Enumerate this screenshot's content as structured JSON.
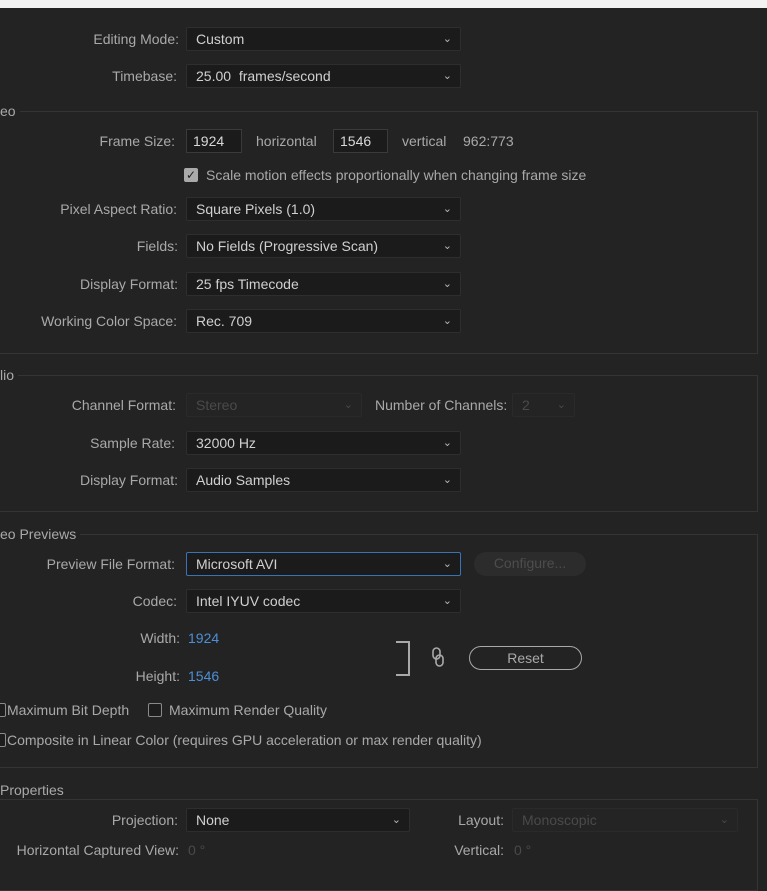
{
  "general": {
    "editing_mode": {
      "label": "Editing Mode:",
      "value": "Custom"
    },
    "timebase": {
      "label": "Timebase:",
      "value": "25.00  frames/second"
    }
  },
  "video": {
    "title": "eo",
    "frame_size": {
      "label": "Frame Size:",
      "width": "1924",
      "horizontal": "horizontal",
      "height": "1546",
      "vertical": "vertical",
      "ratio": "962:773"
    },
    "scale_checkbox": {
      "label": "Scale motion effects proportionally when changing frame size",
      "checked": true
    },
    "pixel_aspect": {
      "label": "Pixel Aspect Ratio:",
      "value": "Square Pixels (1.0)"
    },
    "fields": {
      "label": "Fields:",
      "value": "No Fields (Progressive Scan)"
    },
    "display_format": {
      "label": "Display Format:",
      "value": "25 fps Timecode"
    },
    "color_space": {
      "label": "Working Color Space:",
      "value": "Rec. 709"
    }
  },
  "audio": {
    "title": "lio",
    "channel_format": {
      "label": "Channel Format:",
      "value": "Stereo"
    },
    "num_channels": {
      "label": "Number of Channels:",
      "value": "2"
    },
    "sample_rate": {
      "label": "Sample Rate:",
      "value": "32000 Hz"
    },
    "display_format": {
      "label": "Display Format:",
      "value": "Audio Samples"
    }
  },
  "previews": {
    "title": "eo Previews",
    "file_format": {
      "label": "Preview File Format:",
      "value": "Microsoft AVI"
    },
    "configure_label": "Configure...",
    "codec": {
      "label": "Codec:",
      "value": "Intel IYUV codec"
    },
    "width": {
      "label": "Width:",
      "value": "1924"
    },
    "height": {
      "label": "Height:",
      "value": "1546"
    },
    "reset_label": "Reset",
    "max_bit_depth": {
      "label": "Maximum Bit Depth",
      "checked": false
    },
    "max_render_quality": {
      "label": "Maximum Render Quality",
      "checked": false
    },
    "composite_linear": {
      "label": "Composite in Linear Color (requires GPU acceleration or max render quality)",
      "checked": false
    }
  },
  "vr": {
    "title": "Properties",
    "projection": {
      "label": "Projection:",
      "value": "None"
    },
    "layout": {
      "label": "Layout:",
      "value": "Monoscopic"
    },
    "h_captured_view": {
      "label": "Horizontal Captured View:",
      "value": "0 °"
    },
    "vertical": {
      "label": "Vertical:",
      "value": "0 °"
    }
  },
  "icons": {
    "chevron": "chevron-down-icon",
    "link": "link-chain-icon",
    "check": "checkmark-icon"
  },
  "colors": {
    "background": "#232323",
    "accent_blue": "#4d8fd6",
    "focus_border": "#3a73b5"
  }
}
